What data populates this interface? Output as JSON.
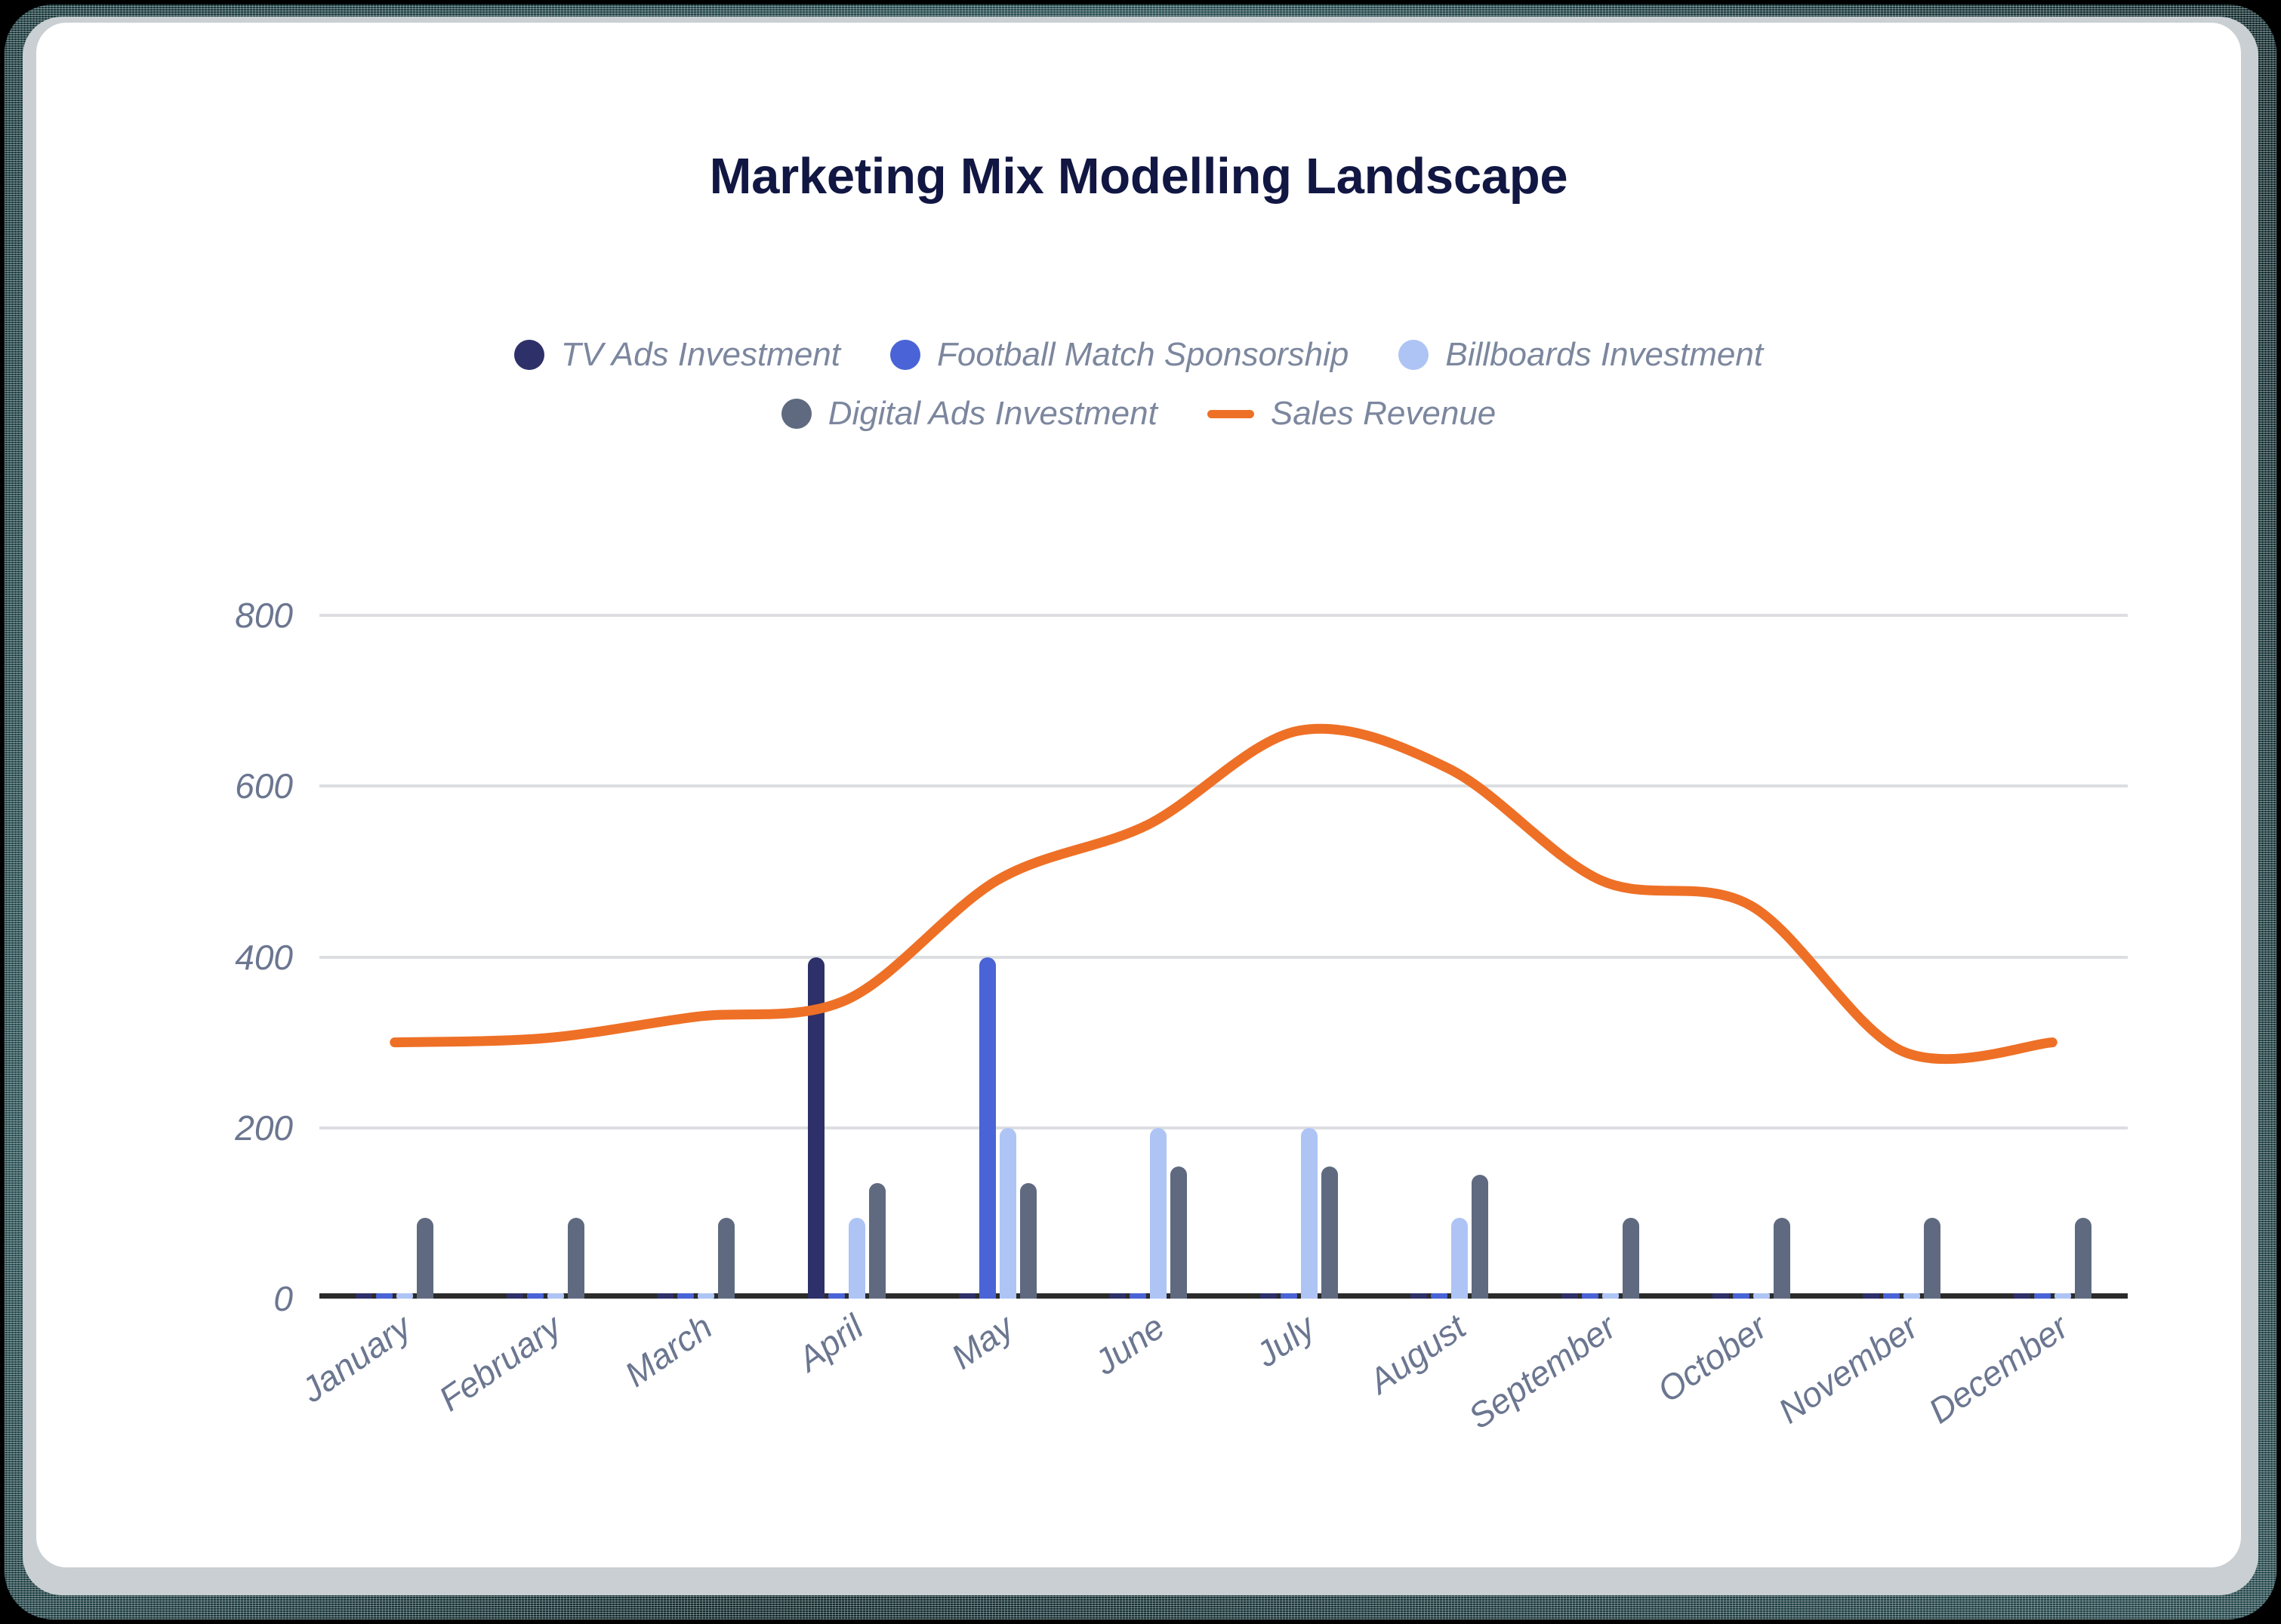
{
  "chart_data": {
    "type": "bar",
    "title": "Marketing Mix Modelling Landscape",
    "xlabel": "",
    "ylabel": "",
    "ylim": [
      0,
      800
    ],
    "yticks": [
      0,
      200,
      400,
      600,
      800
    ],
    "grid": true,
    "legend_position": "top-center",
    "categories": [
      "January",
      "February",
      "March",
      "April",
      "May",
      "June",
      "July",
      "August",
      "September",
      "October",
      "November",
      "December"
    ],
    "series": [
      {
        "name": "TV Ads Investment",
        "type": "bar",
        "color": "#2e3069",
        "values": [
          0,
          0,
          0,
          400,
          0,
          0,
          0,
          0,
          0,
          0,
          0,
          0
        ]
      },
      {
        "name": "Football Match Sponsorship",
        "type": "bar",
        "color": "#4a63d6",
        "values": [
          0,
          0,
          0,
          0,
          400,
          0,
          0,
          0,
          0,
          0,
          0,
          0
        ]
      },
      {
        "name": "Billboards Investment",
        "type": "bar",
        "color": "#aec4f5",
        "values": [
          0,
          0,
          0,
          95,
          200,
          200,
          200,
          95,
          0,
          0,
          0,
          0
        ]
      },
      {
        "name": "Digital Ads Investment",
        "type": "bar",
        "color": "#5f6a80",
        "values": [
          95,
          95,
          95,
          135,
          135,
          155,
          155,
          145,
          95,
          95,
          95,
          95
        ]
      },
      {
        "name": "Sales Revenue",
        "type": "line",
        "color": "#ee7026",
        "values": [
          300,
          305,
          330,
          350,
          490,
          555,
          665,
          620,
          490,
          460,
          290,
          300
        ]
      }
    ]
  },
  "legend": {
    "items": [
      {
        "label": "TV Ads Investment",
        "color": "#2e3069",
        "marker": "dot"
      },
      {
        "label": "Football Match Sponsorship",
        "color": "#4a63d6",
        "marker": "dot"
      },
      {
        "label": "Billboards Investment",
        "color": "#aec4f5",
        "marker": "dot"
      },
      {
        "label": "Digital Ads Investment",
        "color": "#5f6a80",
        "marker": "dot"
      },
      {
        "label": "Sales Revenue",
        "color": "#ee7026",
        "marker": "line"
      }
    ]
  },
  "theme": {
    "background": "#ffffff",
    "title_color": "#111742",
    "tick_color": "#6b7690",
    "grid_color": "#dcdee1",
    "axis_color": "#2b2b2b",
    "frame_color": "#204a4f"
  }
}
